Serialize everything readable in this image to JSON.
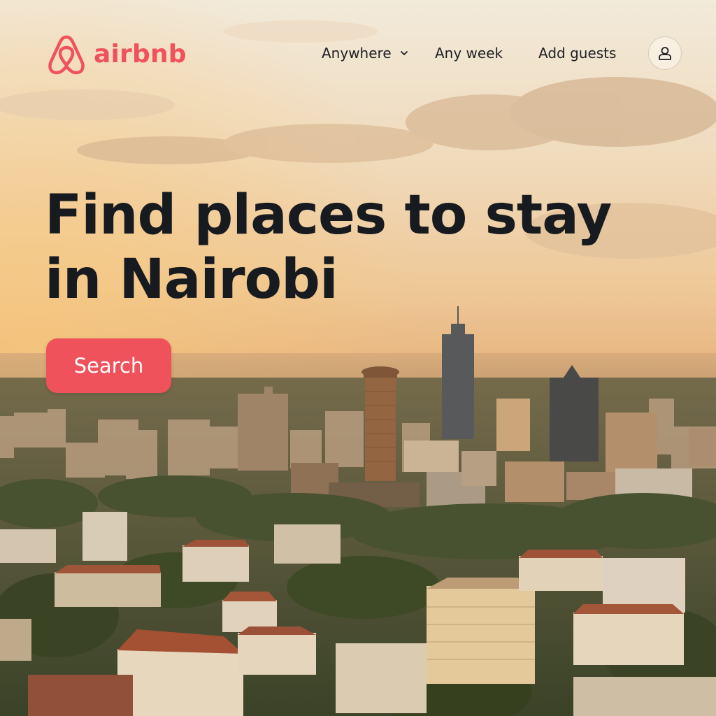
{
  "brand": {
    "name": "airbnb",
    "color": "#f0525b",
    "logo_icon": "airbnb-belo-icon"
  },
  "nav": {
    "anywhere_label": "Anywhere",
    "anywhere_icon": "chevron-down-icon",
    "week_label": "Any week",
    "guests_label": "Add guests",
    "profile_icon": "user-icon"
  },
  "hero": {
    "title_line1": "Find places to stay",
    "title_line2": "in Nairobi",
    "search_label": "Search",
    "background": "Nairobi skyline at sunset"
  }
}
